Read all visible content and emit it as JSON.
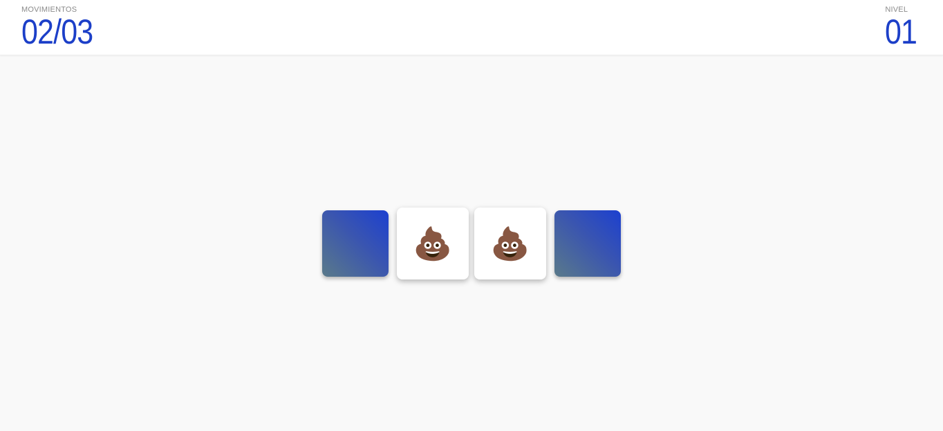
{
  "hud": {
    "moves_label": "MOVIMIENTOS",
    "moves_value": "02/03",
    "level_label": "NIVEL",
    "level_value": "01"
  },
  "colors": {
    "accent": "#1c3fc8",
    "card_back_start": "#5a7a8a",
    "card_back_end": "#1c40d0"
  },
  "cards": [
    {
      "state": "face-down",
      "symbol": ""
    },
    {
      "state": "face-up",
      "symbol": "💩",
      "icon": "pile-of-poo-icon"
    },
    {
      "state": "face-up",
      "symbol": "💩",
      "icon": "pile-of-poo-icon"
    },
    {
      "state": "face-down",
      "symbol": ""
    }
  ]
}
